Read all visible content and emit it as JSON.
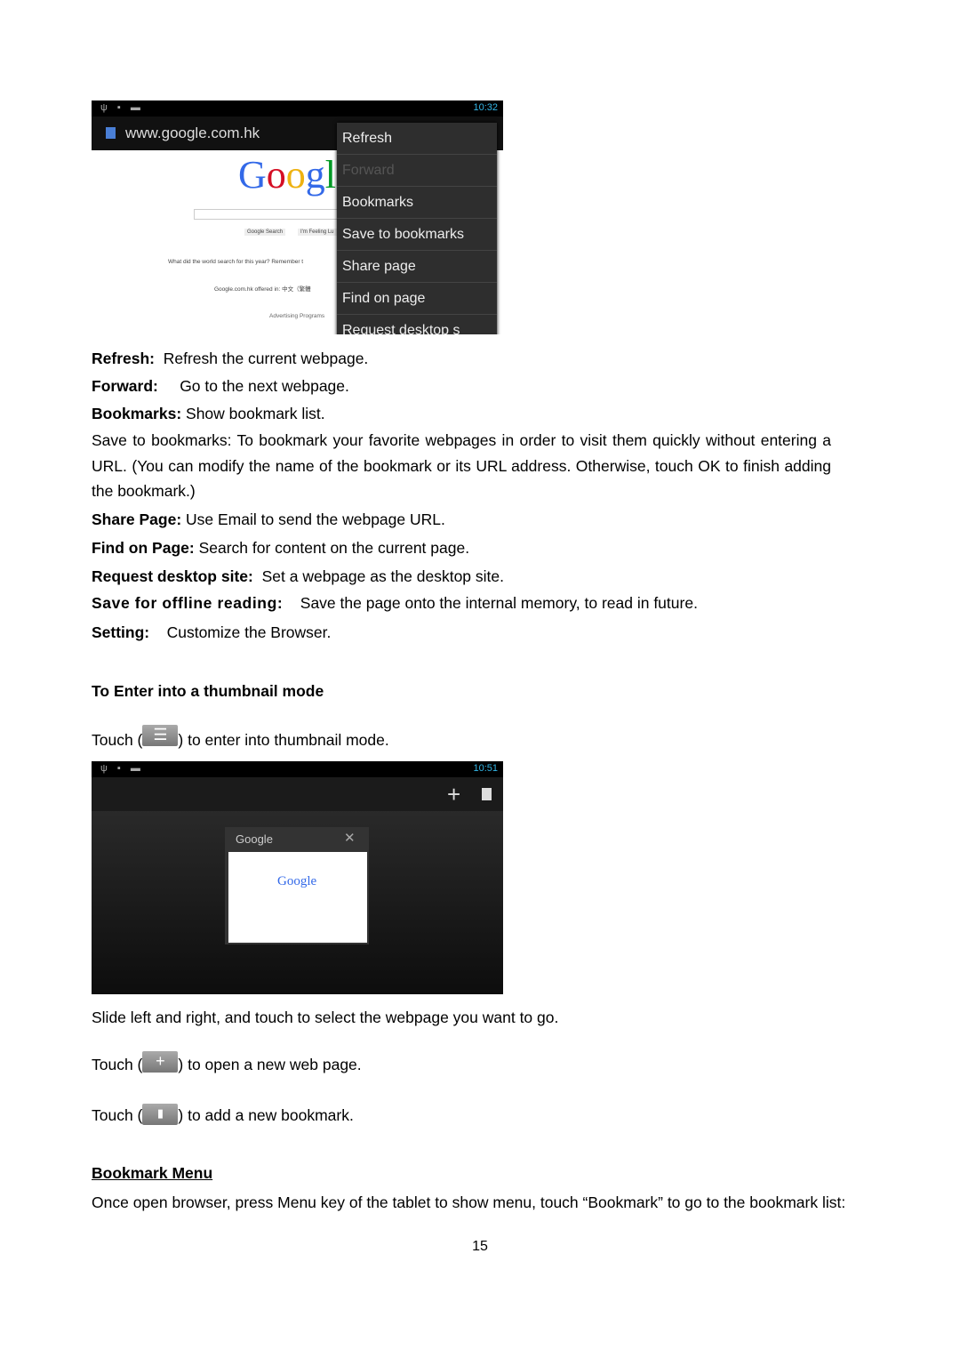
{
  "screenshot1": {
    "status_time": "10:32",
    "url": "www.google.com.hk",
    "page_snippets": [
      "Google Search",
      "I'm Feeling Lu",
      "What did the world search for this year? Remember t",
      "Google.com.hk offered in: 中文（繁體",
      "Advertising Programs"
    ],
    "menu_items": [
      {
        "label": "Refresh",
        "enabled": true
      },
      {
        "label": "Forward",
        "enabled": false
      },
      {
        "label": "Bookmarks",
        "enabled": true
      },
      {
        "label": "Save to bookmarks",
        "enabled": true
      },
      {
        "label": "Share page",
        "enabled": true
      },
      {
        "label": "Find on page",
        "enabled": true
      },
      {
        "label": "Request desktop s",
        "enabled": true
      }
    ]
  },
  "definitions": [
    {
      "term": "Refresh:",
      "text": "Refresh the current webpage."
    },
    {
      "term": "Forward:",
      "text": "Go to the next webpage."
    },
    {
      "term": "Bookmarks:",
      "text": "Show bookmark list."
    }
  ],
  "save_to_bookmarks_para": "Save to bookmarks: To bookmark your favorite webpages in order to visit them quickly without entering a URL. (You can modify the name of the bookmark or its URL address. Otherwise, touch OK to finish adding the bookmark.)",
  "definitions2": [
    {
      "term": "Share Page:",
      "text": "Use Email to send the webpage URL."
    },
    {
      "term": "Find on Page:",
      "text": "Search for content on the current page."
    },
    {
      "term": "Request desktop site:",
      "text": "Set a webpage as the desktop site."
    },
    {
      "term": "Save for offline reading:",
      "text": "Save the page onto the internal memory, to read in future."
    },
    {
      "term": "Setting:",
      "text": "Customize the Browser."
    }
  ],
  "thumbnail_heading": "To Enter into a thumbnail mode",
  "thumb_touch": {
    "pre": "Touch (",
    "post": ") to enter into thumbnail mode."
  },
  "screenshot2": {
    "status_time": "10:51",
    "tab_title": "Google",
    "thumb_logo": "Google"
  },
  "slide_text": "Slide left and right, and touch to select the webpage you want to go.",
  "touch_new": {
    "pre": "Touch (",
    "post": ") to open a new web page."
  },
  "touch_bookmark": {
    "pre": "Touch (",
    "post": ") to add a new bookmark."
  },
  "bookmark_heading": "Bookmark Menu",
  "bookmark_para": "Once open browser, press Menu key of the tablet to show menu, touch “Bookmark” to go to the bookmark list:",
  "page_number": "15"
}
